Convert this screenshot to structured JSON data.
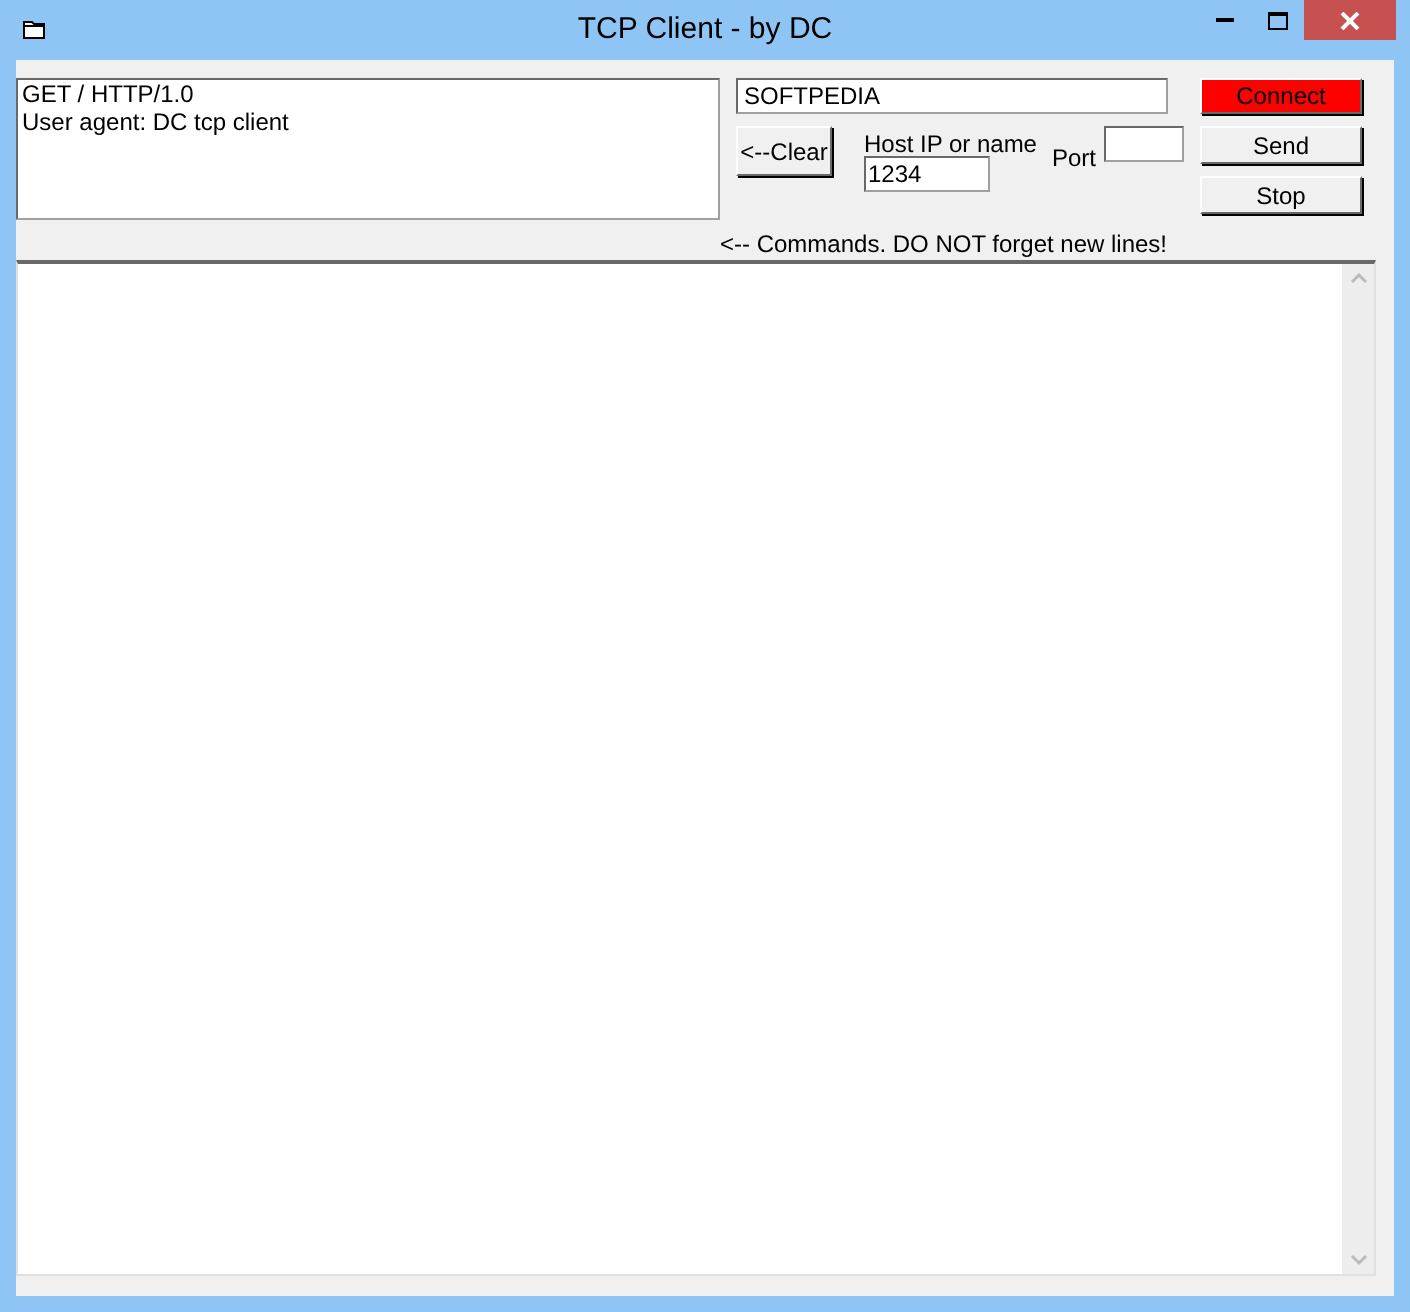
{
  "window": {
    "title": "TCP Client - by DC"
  },
  "commands": {
    "lines": [
      "GET / HTTP/1.0",
      "User agent: DC tcp client"
    ]
  },
  "host_field": {
    "value": "SOFTPEDIA"
  },
  "clear_button": {
    "label": "<--Clear"
  },
  "host_label": "Host IP or name",
  "host_ip_field": {
    "value": "1234"
  },
  "port_label": "Port",
  "note": "<-- Commands.  DO NOT forget new lines!",
  "buttons": [
    {
      "label": "Connect",
      "color": "#ff0000"
    },
    {
      "label": "Send",
      "color": "#f0f0f0"
    },
    {
      "label": "Stop",
      "color": "#f0f0f0"
    }
  ]
}
